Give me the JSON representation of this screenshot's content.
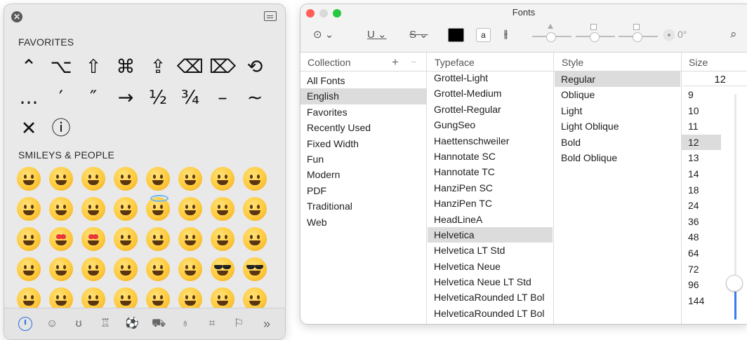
{
  "emoji_viewer": {
    "favorites_title": "FAVORITES",
    "favorites_symbols": [
      "⌃",
      "⌥",
      "⇧",
      "⌘",
      "⇪",
      "⌫",
      "⌦",
      "⟲",
      "…",
      "′",
      "″",
      "→",
      "½",
      "¾",
      "–",
      "~",
      "✕",
      "ⓘ"
    ],
    "smileys_title": "SMILEYS & PEOPLE",
    "categories": [
      "clock-icon",
      "smiley-icon",
      "bear-icon",
      "cake-icon",
      "soccer-ball-icon",
      "car-icon",
      "lightbulb-icon",
      "symbols-icon",
      "flag-icon"
    ],
    "more_label": "»"
  },
  "fonts_window": {
    "title": "Fonts",
    "angle_label": "0°",
    "headers": {
      "collection": "Collection",
      "typeface": "Typeface",
      "style": "Style",
      "size": "Size"
    },
    "add_label": "+",
    "remove_label": "−",
    "collections": [
      "All Fonts",
      "English",
      "Favorites",
      "Recently Used",
      "Fixed Width",
      "Fun",
      "Modern",
      "PDF",
      "Traditional",
      "Web"
    ],
    "selected_collection": "English",
    "typefaces": [
      "Grottel-Light",
      "Grottel-Medium",
      "Grottel-Regular",
      "GungSeo",
      "Haettenschweiler",
      "Hannotate SC",
      "Hannotate TC",
      "HanziPen SC",
      "HanziPen TC",
      "HeadLineA",
      "Helvetica",
      "Helvetica LT Std",
      "Helvetica Neue",
      "Helvetica Neue LT Std",
      "HelveticaRounded LT Bol",
      "HelveticaRounded LT Bol"
    ],
    "selected_typeface": "Helvetica",
    "styles": [
      "Regular",
      "Oblique",
      "Light",
      "Light Oblique",
      "Bold",
      "Bold Oblique"
    ],
    "selected_style": "Regular",
    "size_value": "12",
    "sizes": [
      "9",
      "10",
      "11",
      "12",
      "13",
      "14",
      "18",
      "24",
      "36",
      "48",
      "64",
      "72",
      "96",
      "144"
    ],
    "selected_size": "12"
  }
}
